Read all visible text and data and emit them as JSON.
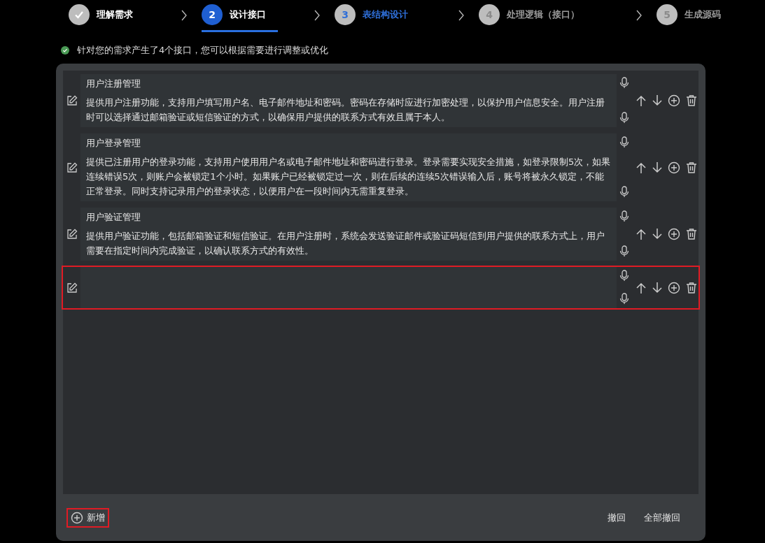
{
  "steps": [
    {
      "label": "理解需求",
      "kind": "done"
    },
    {
      "number": "2",
      "label": "设计接口",
      "kind": "current"
    },
    {
      "number": "3",
      "label": "表结构设计",
      "kind": "next"
    },
    {
      "number": "4",
      "label": "处理逻辑（接口）",
      "kind": "pending"
    },
    {
      "number": "5",
      "label": "生成源码",
      "kind": "pending"
    }
  ],
  "message": "针对您的需求产生了4个接口，您可以根据需要进行调整或优化",
  "interfaces": [
    {
      "title": "用户注册管理",
      "description": "提供用户注册功能，支持用户填写用户名、电子邮件地址和密码。密码在存储时应进行加密处理，以保护用户信息安全。用户注册时可以选择通过邮箱验证或短信验证的方式，以确保用户提供的联系方式有效且属于本人。",
      "highlighted": false
    },
    {
      "title": "用户登录管理",
      "description": "提供已注册用户的登录功能，支持用户使用用户名或电子邮件地址和密码进行登录。登录需要实现安全措施，如登录限制5次，如果连续错误5次，则账户会被锁定1个小时。如果账户已经被锁定过一次，则在后续的连续5次错误输入后，账号将被永久锁定，不能正常登录。同时支持记录用户的登录状态，以便用户在一段时间内无需重复登录。",
      "highlighted": false
    },
    {
      "title": "用户验证管理",
      "description": "提供用户验证功能，包括邮箱验证和短信验证。在用户注册时，系统会发送验证邮件或验证码短信到用户提供的联系方式上，用户需要在指定时间内完成验证，以确认联系方式的有效性。",
      "highlighted": false
    },
    {
      "highlighted": true
    }
  ],
  "add_button": {
    "label": "新增",
    "highlighted": true
  },
  "footer_buttons": [
    "撤回",
    "全部撤回"
  ]
}
